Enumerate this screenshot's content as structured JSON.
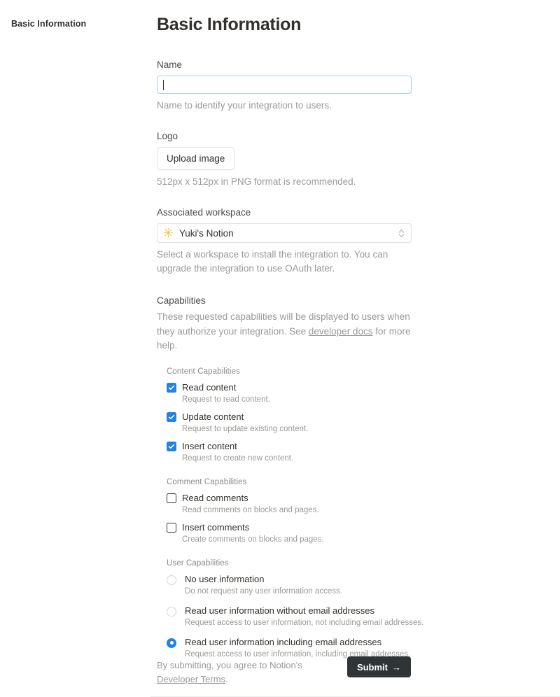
{
  "sidebar": {
    "items": [
      {
        "label": "Basic Information"
      }
    ]
  },
  "page": {
    "title": "Basic Information"
  },
  "name_field": {
    "label": "Name",
    "value": "",
    "placeholder": "",
    "hint": "Name to identify your integration to users."
  },
  "logo_field": {
    "label": "Logo",
    "button_label": "Upload image",
    "hint": "512px x 512px in PNG format is recommended."
  },
  "workspace_field": {
    "label": "Associated workspace",
    "emoji": "☀",
    "selected": "Yuki's Notion",
    "hint": "Select a workspace to install the integration to. You can upgrade the integration to use OAuth later."
  },
  "capabilities": {
    "heading": "Capabilities",
    "description_before": "These requested capabilities will be displayed to users when they authorize your integration. See ",
    "link_label": "developer docs",
    "description_after": " for more help.",
    "groups": [
      {
        "title": "Content Capabilities",
        "type": "checkbox",
        "options": [
          {
            "label": "Read content",
            "sub": "Request to read content.",
            "checked": true
          },
          {
            "label": "Update content",
            "sub": "Request to update existing content.",
            "checked": true
          },
          {
            "label": "Insert content",
            "sub": "Request to create new content.",
            "checked": true
          }
        ]
      },
      {
        "title": "Comment Capabilities",
        "type": "checkbox",
        "options": [
          {
            "label": "Read comments",
            "sub": "Read comments on blocks and pages.",
            "checked": false
          },
          {
            "label": "Insert comments",
            "sub": "Create comments on blocks and pages.",
            "checked": false
          }
        ]
      },
      {
        "title": "User Capabilities",
        "type": "radio",
        "options": [
          {
            "label": "No user information",
            "sub": "Do not request any user information access.",
            "checked": false
          },
          {
            "label": "Read user information without email addresses",
            "sub": "Request access to user information, not including email addresses.",
            "checked": false
          },
          {
            "label": "Read user information including email addresses",
            "sub": "Request access to user information, including email addresses.",
            "checked": true
          }
        ]
      }
    ]
  },
  "footer": {
    "text_before": "By submitting, you agree to Notion's ",
    "link_label": "Developer Terms",
    "text_after": ".",
    "submit_label": "Submit",
    "submit_arrow": "→"
  },
  "colors": {
    "accent_blue": "#2383e2",
    "focus_border": "#a8cdf0",
    "button_dark": "#2f3437",
    "text_primary": "#32302c",
    "text_muted": "#9b9a97"
  }
}
